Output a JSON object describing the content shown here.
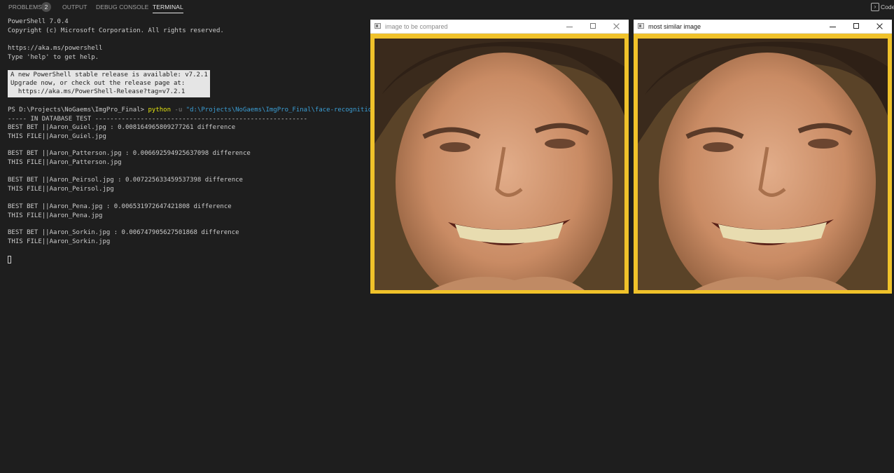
{
  "panel": {
    "tabs": [
      {
        "label": "PROBLEMS",
        "active": false
      },
      {
        "label": "OUTPUT",
        "active": false
      },
      {
        "label": "DEBUG CONSOLE",
        "active": false
      },
      {
        "label": "TERMINAL",
        "active": true
      }
    ],
    "problems_count": "2",
    "right_label": "Code"
  },
  "terminal": {
    "header": [
      "PowerShell 7.0.4",
      "Copyright (c) Microsoft Corporation. All rights reserved.",
      "",
      "https://aka.ms/powershell",
      "Type 'help' to get help."
    ],
    "notice": [
      "A new PowerShell stable release is available: v7.2.1",
      "Upgrade now, or check out the release page at:",
      "  https://aka.ms/PowerShell-Release?tag=v7.2.1"
    ],
    "prompt": "PS D:\\Projects\\NoGaems\\ImgPro_Final> ",
    "command": "python",
    "command_flag": " -u ",
    "command_arg": "\"d:\\Projects\\NoGaems\\ImgPro_Final\\face-recognition.py\"",
    "output": [
      "----- IN DATABASE TEST --------------------------------------------------------",
      "BEST BET ||Aaron_Guiel.jpg : 0.008164965809277261 difference",
      "THIS FILE||Aaron_Guiel.jpg",
      "",
      "BEST BET ||Aaron_Patterson.jpg : 0.006692594925637098 difference",
      "THIS FILE||Aaron_Patterson.jpg",
      "",
      "BEST BET ||Aaron_Peirsol.jpg : 0.007225633459537398 difference",
      "THIS FILE||Aaron_Peirsol.jpg",
      "",
      "BEST BET ||Aaron_Pena.jpg : 0.006531972647421808 difference",
      "THIS FILE||Aaron_Pena.jpg",
      "",
      "BEST BET ||Aaron_Sorkin.jpg : 0.006747905627501868 difference",
      "THIS FILE||Aaron_Sorkin.jpg"
    ]
  },
  "windows": [
    {
      "title": "image to be compared",
      "active": false
    },
    {
      "title": "most similar image",
      "active": true
    }
  ],
  "colors": {
    "terminal_bg": "#1e1e1e",
    "image_border": "#f0c22a",
    "python_keyword": "#e5e510",
    "string_arg": "#3b9fd6"
  }
}
